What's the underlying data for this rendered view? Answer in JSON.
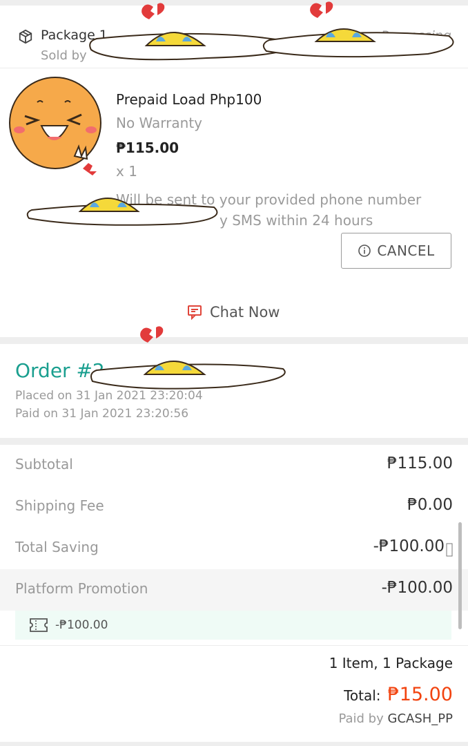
{
  "package": {
    "title": "Package 1",
    "sold_by_label": "Sold by",
    "status": "Processing",
    "icon": "package-icon"
  },
  "product": {
    "name": "Prepaid Load Php100",
    "warranty": "No Warranty",
    "price": "₱115.00",
    "quantity": "x 1",
    "note_line1": "Will be sent to your provided phone number",
    "note_line2": "y SMS within 24 hours"
  },
  "actions": {
    "cancel_label": "CANCEL",
    "chat_label": "Chat Now"
  },
  "order": {
    "title": "Order #2",
    "placed": "Placed on 31 Jan 2021  23:20:04",
    "paid": "Paid on 31 Jan 2021  23:20:56"
  },
  "summary": {
    "rows": [
      {
        "label": "Subtotal",
        "value": "₱115.00"
      },
      {
        "label": "Shipping Fee",
        "value": "₱0.00"
      },
      {
        "label": "Total Saving",
        "value": "-₱100.00"
      },
      {
        "label": "Platform Promotion",
        "value": "-₱100.00"
      }
    ],
    "voucher_amount": "-₱100.00",
    "items_line": "1 Item, 1 Package",
    "total_label": "Total:",
    "total_value": "₱15.00",
    "paid_by_label": "Paid by",
    "paid_by_method": "GCASH_PP"
  },
  "colors": {
    "accent_teal": "#1a9f8f",
    "total_orange": "#f2430f",
    "voucher_bg": "#effbf6"
  }
}
